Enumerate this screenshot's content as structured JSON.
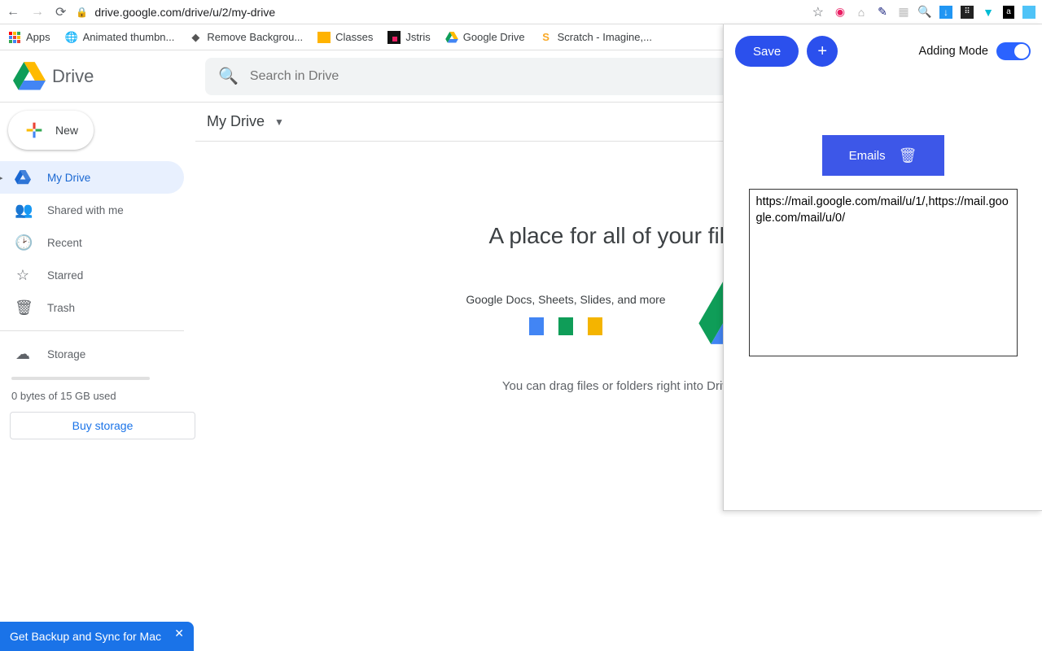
{
  "browser": {
    "url": "drive.google.com/drive/u/2/my-drive",
    "bookmarks": [
      {
        "label": "Apps",
        "icon": "apps"
      },
      {
        "label": "Animated thumbn...",
        "icon": "globe"
      },
      {
        "label": "Remove Backgrou...",
        "icon": "diamond"
      },
      {
        "label": "Classes",
        "icon": "classroom"
      },
      {
        "label": "Jstris",
        "icon": "jstris"
      },
      {
        "label": "Google Drive",
        "icon": "drive"
      },
      {
        "label": "Scratch - Imagine,...",
        "icon": "scratch"
      }
    ]
  },
  "drive": {
    "product": "Drive",
    "search_placeholder": "Search in Drive",
    "new_button": "New",
    "nav": [
      {
        "label": "My Drive",
        "icon": "mydrive",
        "active": true
      },
      {
        "label": "Shared with me",
        "icon": "shared"
      },
      {
        "label": "Recent",
        "icon": "recent"
      },
      {
        "label": "Starred",
        "icon": "starred"
      },
      {
        "label": "Trash",
        "icon": "trash"
      }
    ],
    "storage_label": "Storage",
    "storage_used": "0 bytes of 15 GB used",
    "buy_button": "Buy storage",
    "breadcrumb": "My Drive",
    "empty_heading": "A place for all of your files",
    "apps_caption": "Google Docs, Sheets, Slides, and more",
    "drag_text": "You can drag files or folders right into Drive"
  },
  "snackbar": {
    "text": "Get Backup and Sync for Mac"
  },
  "extension": {
    "save": "Save",
    "add": "+",
    "mode_label": "Adding Mode",
    "group_name": "Emails",
    "urls": "https://mail.google.com/mail/u/1/,https://mail.google.com/mail/u/0/"
  }
}
